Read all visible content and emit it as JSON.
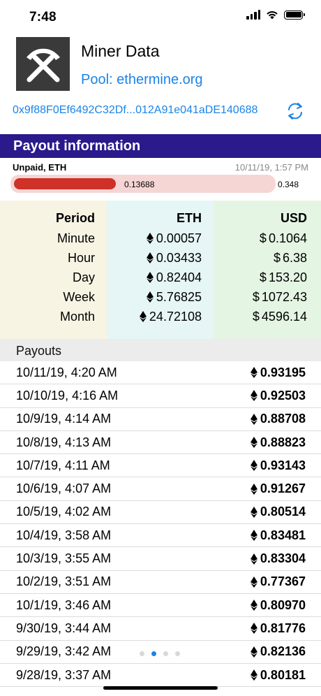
{
  "status": {
    "time": "7:48"
  },
  "header": {
    "title": "Miner Data",
    "pool": "Pool: ethermine.org",
    "wallet": "0x9f88F0Ef6492C32Df...012A91e041aDE140688"
  },
  "payout_info": {
    "title": "Payout information",
    "unpaid_label": "Unpaid, ETH",
    "updated": "10/11/19, 1:57 PM",
    "current": "0.13688",
    "threshold": "0.348",
    "progress_fraction": 0.3933
  },
  "earnings": {
    "headers": {
      "period": "Period",
      "eth": "ETH",
      "usd": "USD"
    },
    "rows": [
      {
        "period": "Minute",
        "eth": "0.00057",
        "usd": "0.1064"
      },
      {
        "period": "Hour",
        "eth": "0.03433",
        "usd": "6.38"
      },
      {
        "period": "Day",
        "eth": "0.82404",
        "usd": "153.20"
      },
      {
        "period": "Week",
        "eth": "5.76825",
        "usd": "1072.43"
      },
      {
        "period": "Month",
        "eth": "24.72108",
        "usd": "4596.14"
      }
    ]
  },
  "payouts": {
    "title": "Payouts",
    "rows": [
      {
        "date": "10/11/19, 4:20 AM",
        "amount": "0.93195"
      },
      {
        "date": "10/10/19, 4:16 AM",
        "amount": "0.92503"
      },
      {
        "date": "10/9/19, 4:14 AM",
        "amount": "0.88708"
      },
      {
        "date": "10/8/19, 4:13 AM",
        "amount": "0.88823"
      },
      {
        "date": "10/7/19, 4:11 AM",
        "amount": "0.93143"
      },
      {
        "date": "10/6/19, 4:07 AM",
        "amount": "0.91267"
      },
      {
        "date": "10/5/19, 4:02 AM",
        "amount": "0.80514"
      },
      {
        "date": "10/4/19, 3:58 AM",
        "amount": "0.83481"
      },
      {
        "date": "10/3/19, 3:55 AM",
        "amount": "0.83304"
      },
      {
        "date": "10/2/19, 3:51 AM",
        "amount": "0.77367"
      },
      {
        "date": "10/1/19, 3:46 AM",
        "amount": "0.80970"
      },
      {
        "date": "9/30/19, 3:44 AM",
        "amount": "0.81776"
      },
      {
        "date": "9/29/19, 3:42 AM",
        "amount": "0.82136"
      },
      {
        "date": "9/28/19, 3:37 AM",
        "amount": "0.80181"
      }
    ]
  },
  "pager": {
    "pages": 4,
    "active": 1
  },
  "colors": {
    "accent": "#1a84e8",
    "section": "#2a1a8c",
    "progress": "#cf3027",
    "progress_track": "#f5d6d4"
  }
}
